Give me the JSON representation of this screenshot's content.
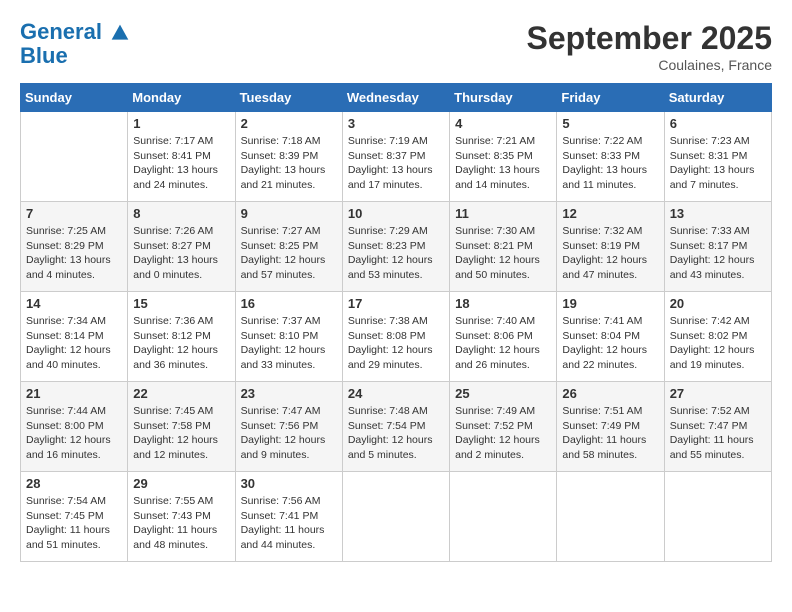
{
  "header": {
    "logo_line1": "General",
    "logo_line2": "Blue",
    "month": "September 2025",
    "location": "Coulaines, France"
  },
  "weekdays": [
    "Sunday",
    "Monday",
    "Tuesday",
    "Wednesday",
    "Thursday",
    "Friday",
    "Saturday"
  ],
  "weeks": [
    [
      {
        "day": "",
        "sunrise": "",
        "sunset": "",
        "daylight": ""
      },
      {
        "day": "1",
        "sunrise": "Sunrise: 7:17 AM",
        "sunset": "Sunset: 8:41 PM",
        "daylight": "Daylight: 13 hours and 24 minutes."
      },
      {
        "day": "2",
        "sunrise": "Sunrise: 7:18 AM",
        "sunset": "Sunset: 8:39 PM",
        "daylight": "Daylight: 13 hours and 21 minutes."
      },
      {
        "day": "3",
        "sunrise": "Sunrise: 7:19 AM",
        "sunset": "Sunset: 8:37 PM",
        "daylight": "Daylight: 13 hours and 17 minutes."
      },
      {
        "day": "4",
        "sunrise": "Sunrise: 7:21 AM",
        "sunset": "Sunset: 8:35 PM",
        "daylight": "Daylight: 13 hours and 14 minutes."
      },
      {
        "day": "5",
        "sunrise": "Sunrise: 7:22 AM",
        "sunset": "Sunset: 8:33 PM",
        "daylight": "Daylight: 13 hours and 11 minutes."
      },
      {
        "day": "6",
        "sunrise": "Sunrise: 7:23 AM",
        "sunset": "Sunset: 8:31 PM",
        "daylight": "Daylight: 13 hours and 7 minutes."
      }
    ],
    [
      {
        "day": "7",
        "sunrise": "Sunrise: 7:25 AM",
        "sunset": "Sunset: 8:29 PM",
        "daylight": "Daylight: 13 hours and 4 minutes."
      },
      {
        "day": "8",
        "sunrise": "Sunrise: 7:26 AM",
        "sunset": "Sunset: 8:27 PM",
        "daylight": "Daylight: 13 hours and 0 minutes."
      },
      {
        "day": "9",
        "sunrise": "Sunrise: 7:27 AM",
        "sunset": "Sunset: 8:25 PM",
        "daylight": "Daylight: 12 hours and 57 minutes."
      },
      {
        "day": "10",
        "sunrise": "Sunrise: 7:29 AM",
        "sunset": "Sunset: 8:23 PM",
        "daylight": "Daylight: 12 hours and 53 minutes."
      },
      {
        "day": "11",
        "sunrise": "Sunrise: 7:30 AM",
        "sunset": "Sunset: 8:21 PM",
        "daylight": "Daylight: 12 hours and 50 minutes."
      },
      {
        "day": "12",
        "sunrise": "Sunrise: 7:32 AM",
        "sunset": "Sunset: 8:19 PM",
        "daylight": "Daylight: 12 hours and 47 minutes."
      },
      {
        "day": "13",
        "sunrise": "Sunrise: 7:33 AM",
        "sunset": "Sunset: 8:17 PM",
        "daylight": "Daylight: 12 hours and 43 minutes."
      }
    ],
    [
      {
        "day": "14",
        "sunrise": "Sunrise: 7:34 AM",
        "sunset": "Sunset: 8:14 PM",
        "daylight": "Daylight: 12 hours and 40 minutes."
      },
      {
        "day": "15",
        "sunrise": "Sunrise: 7:36 AM",
        "sunset": "Sunset: 8:12 PM",
        "daylight": "Daylight: 12 hours and 36 minutes."
      },
      {
        "day": "16",
        "sunrise": "Sunrise: 7:37 AM",
        "sunset": "Sunset: 8:10 PM",
        "daylight": "Daylight: 12 hours and 33 minutes."
      },
      {
        "day": "17",
        "sunrise": "Sunrise: 7:38 AM",
        "sunset": "Sunset: 8:08 PM",
        "daylight": "Daylight: 12 hours and 29 minutes."
      },
      {
        "day": "18",
        "sunrise": "Sunrise: 7:40 AM",
        "sunset": "Sunset: 8:06 PM",
        "daylight": "Daylight: 12 hours and 26 minutes."
      },
      {
        "day": "19",
        "sunrise": "Sunrise: 7:41 AM",
        "sunset": "Sunset: 8:04 PM",
        "daylight": "Daylight: 12 hours and 22 minutes."
      },
      {
        "day": "20",
        "sunrise": "Sunrise: 7:42 AM",
        "sunset": "Sunset: 8:02 PM",
        "daylight": "Daylight: 12 hours and 19 minutes."
      }
    ],
    [
      {
        "day": "21",
        "sunrise": "Sunrise: 7:44 AM",
        "sunset": "Sunset: 8:00 PM",
        "daylight": "Daylight: 12 hours and 16 minutes."
      },
      {
        "day": "22",
        "sunrise": "Sunrise: 7:45 AM",
        "sunset": "Sunset: 7:58 PM",
        "daylight": "Daylight: 12 hours and 12 minutes."
      },
      {
        "day": "23",
        "sunrise": "Sunrise: 7:47 AM",
        "sunset": "Sunset: 7:56 PM",
        "daylight": "Daylight: 12 hours and 9 minutes."
      },
      {
        "day": "24",
        "sunrise": "Sunrise: 7:48 AM",
        "sunset": "Sunset: 7:54 PM",
        "daylight": "Daylight: 12 hours and 5 minutes."
      },
      {
        "day": "25",
        "sunrise": "Sunrise: 7:49 AM",
        "sunset": "Sunset: 7:52 PM",
        "daylight": "Daylight: 12 hours and 2 minutes."
      },
      {
        "day": "26",
        "sunrise": "Sunrise: 7:51 AM",
        "sunset": "Sunset: 7:49 PM",
        "daylight": "Daylight: 11 hours and 58 minutes."
      },
      {
        "day": "27",
        "sunrise": "Sunrise: 7:52 AM",
        "sunset": "Sunset: 7:47 PM",
        "daylight": "Daylight: 11 hours and 55 minutes."
      }
    ],
    [
      {
        "day": "28",
        "sunrise": "Sunrise: 7:54 AM",
        "sunset": "Sunset: 7:45 PM",
        "daylight": "Daylight: 11 hours and 51 minutes."
      },
      {
        "day": "29",
        "sunrise": "Sunrise: 7:55 AM",
        "sunset": "Sunset: 7:43 PM",
        "daylight": "Daylight: 11 hours and 48 minutes."
      },
      {
        "day": "30",
        "sunrise": "Sunrise: 7:56 AM",
        "sunset": "Sunset: 7:41 PM",
        "daylight": "Daylight: 11 hours and 44 minutes."
      },
      {
        "day": "",
        "sunrise": "",
        "sunset": "",
        "daylight": ""
      },
      {
        "day": "",
        "sunrise": "",
        "sunset": "",
        "daylight": ""
      },
      {
        "day": "",
        "sunrise": "",
        "sunset": "",
        "daylight": ""
      },
      {
        "day": "",
        "sunrise": "",
        "sunset": "",
        "daylight": ""
      }
    ]
  ]
}
